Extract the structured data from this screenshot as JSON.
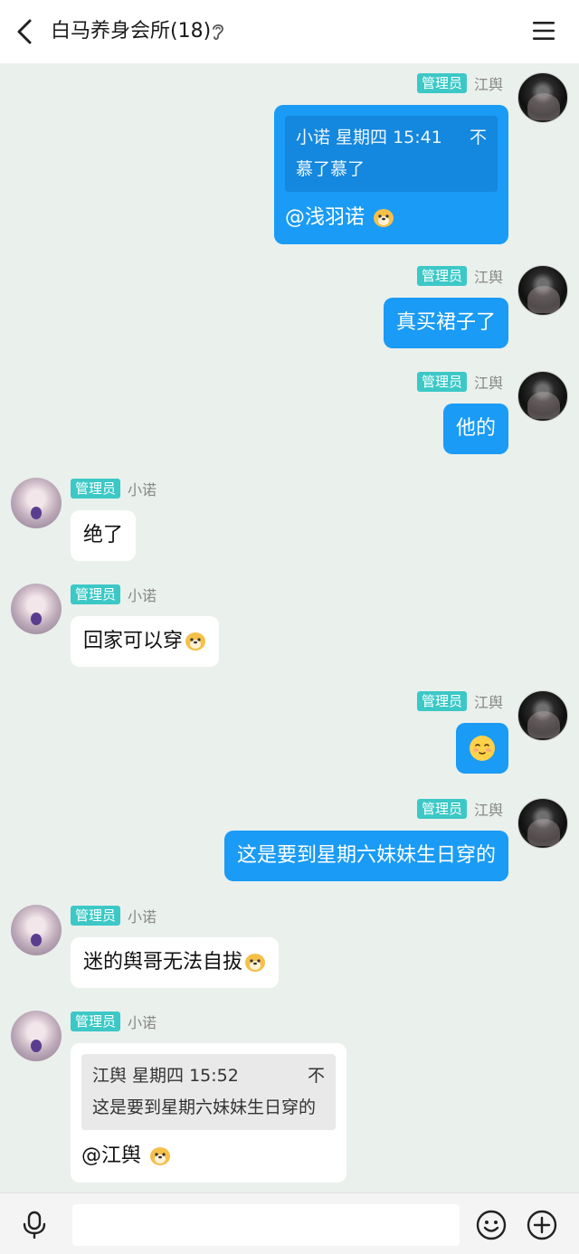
{
  "header": {
    "title": "白马养身会所(18)"
  },
  "messages": [
    {
      "badge": "管理员",
      "sender": "江舆",
      "quote_header": "小诺 星期四 15:41",
      "quote_close": "不",
      "quote_body": "慕了慕了",
      "mention": "@浅羽诺"
    },
    {
      "badge": "管理员",
      "sender": "江舆",
      "text": "真买裙子了"
    },
    {
      "badge": "管理员",
      "sender": "江舆",
      "text": "他的"
    },
    {
      "badge": "管理员",
      "sender": "小诺",
      "text": "绝了"
    },
    {
      "badge": "管理员",
      "sender": "小诺",
      "text": "回家可以穿"
    },
    {
      "badge": "管理员",
      "sender": "江舆"
    },
    {
      "badge": "管理员",
      "sender": "江舆",
      "text": "这是要到星期六妹妹生日穿的"
    },
    {
      "badge": "管理员",
      "sender": "小诺",
      "text": "迷的舆哥无法自拔"
    },
    {
      "badge": "管理员",
      "sender": "小诺",
      "quote_header": "江舆 星期四 15:52",
      "quote_close": "不",
      "quote_body": "这是要到星期六妹妹生日穿的",
      "mention": "@江舆"
    }
  ],
  "colors": {
    "accent": "#1a9bf5",
    "badge": "#3cc8c6",
    "background": "#eaf0ec"
  },
  "icons": {
    "back": "back-arrow-icon",
    "menu": "menu-icon",
    "mic": "microphone-icon",
    "emoji": "smile-icon",
    "plus": "plus-icon"
  }
}
